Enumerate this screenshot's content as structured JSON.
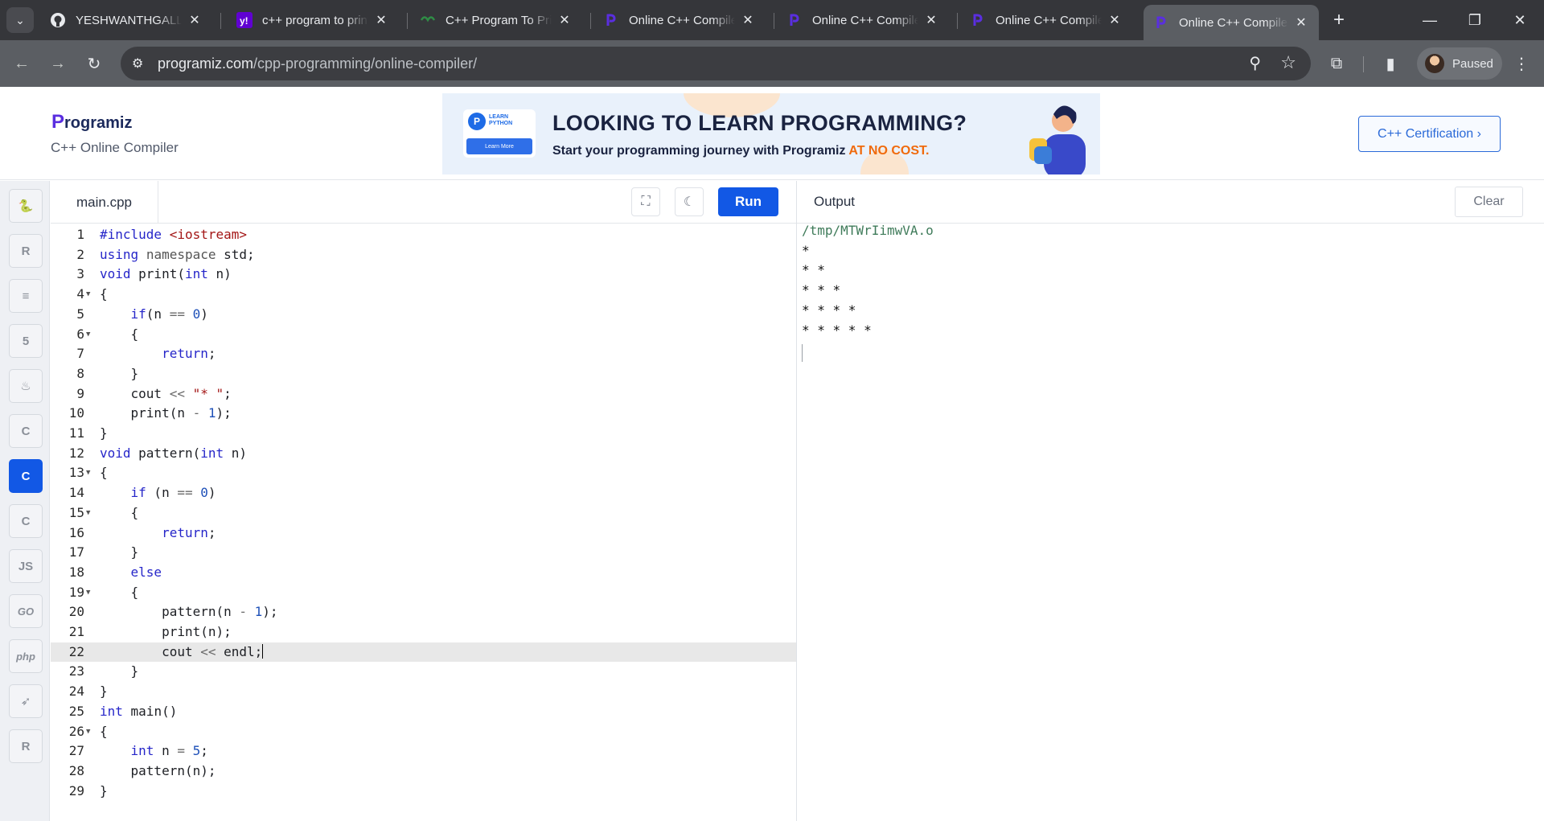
{
  "browser": {
    "tabs": [
      {
        "title": "YESHWANTHGALLA/",
        "icon": "github-icon"
      },
      {
        "title": "c++ program to print",
        "icon": "yahoo-icon"
      },
      {
        "title": "C++ Program To Print",
        "icon": "geeksforgeeks-icon"
      },
      {
        "title": "Online C++ Compiler",
        "icon": "programiz-icon"
      },
      {
        "title": "Online C++ Compiler",
        "icon": "programiz-icon"
      },
      {
        "title": "Online C++ Compiler",
        "icon": "programiz-icon"
      },
      {
        "title": "Online C++ Compiler",
        "icon": "programiz-icon",
        "active": true
      }
    ],
    "url_host": "programiz.com",
    "url_path": "/cpp-programming/online-compiler/",
    "profile_label": "Paused"
  },
  "header": {
    "logo": "rogramiz",
    "logo_mark": "P",
    "subtitle": "C++ Online Compiler",
    "banner": {
      "badge_logo": "P",
      "badge_text": "LEARN PYTHON",
      "badge_button": "Learn More",
      "headline": "LOOKING TO LEARN PROGRAMMING?",
      "subline": "Start your programming journey with Programiz ",
      "subline_highlight": "AT NO COST."
    },
    "cert_button": "C++ Certification ›"
  },
  "sidebar": {
    "languages": [
      {
        "name": "python",
        "glyph": "🐍"
      },
      {
        "name": "r",
        "glyph": "R"
      },
      {
        "name": "sql",
        "glyph": "≡"
      },
      {
        "name": "html",
        "glyph": "5"
      },
      {
        "name": "java",
        "glyph": "♨"
      },
      {
        "name": "c",
        "glyph": "C"
      },
      {
        "name": "cpp",
        "glyph": "C",
        "active": true
      },
      {
        "name": "csharp",
        "glyph": "C"
      },
      {
        "name": "javascript",
        "glyph": "JS"
      },
      {
        "name": "go",
        "glyph": "GO"
      },
      {
        "name": "php",
        "glyph": "php"
      },
      {
        "name": "swift",
        "glyph": "➶"
      },
      {
        "name": "rust",
        "glyph": "R"
      }
    ]
  },
  "editor": {
    "filename": "main.cpp",
    "run_label": "Run",
    "current_line": 22,
    "lines": [
      {
        "n": "1",
        "fold": false,
        "code": "#include <iostream>"
      },
      {
        "n": "2",
        "fold": false,
        "code": "using namespace std;"
      },
      {
        "n": "3",
        "fold": false,
        "code": "void print(int n)"
      },
      {
        "n": "4",
        "fold": true,
        "code": "{"
      },
      {
        "n": "5",
        "fold": false,
        "code": "    if(n == 0)"
      },
      {
        "n": "6",
        "fold": true,
        "code": "    {"
      },
      {
        "n": "7",
        "fold": false,
        "code": "        return;"
      },
      {
        "n": "8",
        "fold": false,
        "code": "    }"
      },
      {
        "n": "9",
        "fold": false,
        "code": "    cout << \"* \";"
      },
      {
        "n": "10",
        "fold": false,
        "code": "    print(n - 1);"
      },
      {
        "n": "11",
        "fold": false,
        "code": "}"
      },
      {
        "n": "12",
        "fold": false,
        "code": "void pattern(int n)"
      },
      {
        "n": "13",
        "fold": true,
        "code": "{"
      },
      {
        "n": "14",
        "fold": false,
        "code": "    if (n == 0)"
      },
      {
        "n": "15",
        "fold": true,
        "code": "    {"
      },
      {
        "n": "16",
        "fold": false,
        "code": "        return;"
      },
      {
        "n": "17",
        "fold": false,
        "code": "    }"
      },
      {
        "n": "18",
        "fold": false,
        "code": "    else"
      },
      {
        "n": "19",
        "fold": true,
        "code": "    {"
      },
      {
        "n": "20",
        "fold": false,
        "code": "        pattern(n - 1);"
      },
      {
        "n": "21",
        "fold": false,
        "code": "        print(n);"
      },
      {
        "n": "22",
        "fold": false,
        "code": "        cout << endl;"
      },
      {
        "n": "23",
        "fold": false,
        "code": "    }"
      },
      {
        "n": "24",
        "fold": false,
        "code": "}"
      },
      {
        "n": "25",
        "fold": false,
        "code": "int main()"
      },
      {
        "n": "26",
        "fold": true,
        "code": "{"
      },
      {
        "n": "27",
        "fold": false,
        "code": "    int n = 5;"
      },
      {
        "n": "28",
        "fold": false,
        "code": "    pattern(n);"
      },
      {
        "n": "29",
        "fold": false,
        "code": "}"
      }
    ]
  },
  "output": {
    "title": "Output",
    "clear_label": "Clear",
    "lines": [
      "/tmp/MTWrIimwVA.o",
      "*",
      "* *",
      "* * *",
      "* * * *",
      "* * * * *"
    ]
  }
}
